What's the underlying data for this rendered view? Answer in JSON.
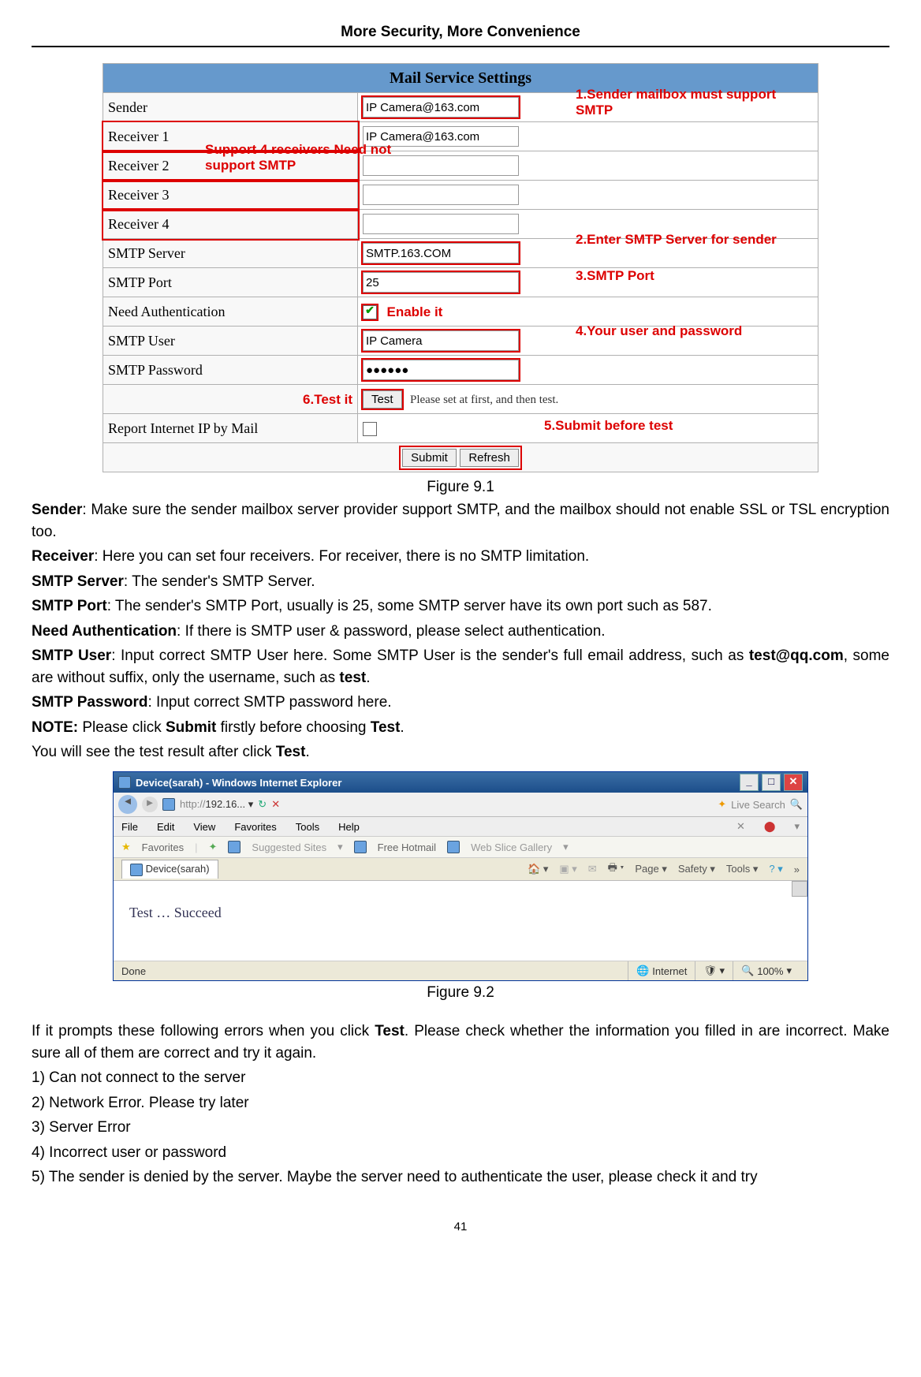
{
  "header": "More Security, More Convenience",
  "mail": {
    "title": "Mail Service Settings",
    "rows": {
      "sender_label": "Sender",
      "sender_val": "IP Camera@163.com",
      "r1_label": "Receiver 1",
      "r1_val": "IP Camera@163.com",
      "r2_label": "Receiver 2",
      "r3_label": "Receiver 3",
      "r4_label": "Receiver 4",
      "smtp_server_label": "SMTP Server",
      "smtp_server_val": "SMTP.163.COM",
      "smtp_port_label": "SMTP Port",
      "smtp_port_val": "25",
      "need_auth_label": "Need Authentication",
      "smtp_user_label": "SMTP User",
      "smtp_user_val": "IP Camera",
      "smtp_pass_label": "SMTP Password",
      "smtp_pass_val": "●●●●●●",
      "test_btn": "Test",
      "test_hint": "Please set at first, and then test.",
      "report_label": "Report Internet IP by Mail",
      "submit_btn": "Submit",
      "refresh_btn": "Refresh"
    },
    "ann": {
      "a1": "1.Sender mailbox must support SMTP",
      "a_recv": "Support 4 receivers Need not support SMTP",
      "a2": "2.Enter SMTP Server for sender",
      "a3": "3.SMTP Port",
      "a_enable": "Enable it",
      "a4": "4.Your user and password",
      "a5": "5.Submit before test",
      "a6": "6.Test it"
    }
  },
  "cap1": "Figure 9.1",
  "desc": {
    "p1a": "Sender",
    "p1b": ": Make sure the sender mailbox server provider support SMTP, and the mailbox should not enable SSL or TSL encryption too.",
    "p2a": "Receiver",
    "p2b": ": Here you can set four receivers. For receiver, there is no SMTP limitation.",
    "p3a": "SMTP Server",
    "p3b": ": The sender's SMTP Server.",
    "p4a": "SMTP Port",
    "p4b": ": The sender's SMTP Port, usually is 25, some SMTP server have its own port such as 587.",
    "p5a": "Need Authentication",
    "p5b": ": If there is SMTP user & password, please select authentication.",
    "p6a": "SMTP User",
    "p6b": ": Input correct SMTP User here. Some SMTP User is the sender's full email address, such as ",
    "p6c": "test@qq.com",
    "p6d": ", some are without suffix, only the username, such as ",
    "p6e": "test",
    "p6f": ".",
    "p7a": "SMTP Password",
    "p7b": ": Input correct SMTP password here.",
    "p8a": "NOTE:",
    "p8b": " Please click ",
    "p8c": "Submit",
    "p8d": " firstly before choosing ",
    "p8e": "Test",
    "p8f": ".",
    "p9a": "You will see the test result after click ",
    "p9b": "Test",
    "p9c": "."
  },
  "ie": {
    "title": "Device(sarah) - Windows Internet Explorer",
    "url_prefix": "http://",
    "url_body": "192.16...",
    "search_hint": "Live Search",
    "menu": [
      "File",
      "Edit",
      "View",
      "Favorites",
      "Tools",
      "Help"
    ],
    "fav_label": "Favorites",
    "suggested": "Suggested Sites",
    "free_hotmail": "Free Hotmail",
    "web_slice": "Web Slice Gallery",
    "tab_name": "Device(sarah)",
    "toolbar_page": "Page",
    "toolbar_safety": "Safety",
    "toolbar_tools": "Tools",
    "body_text": "Test   …   Succeed",
    "status_done": "Done",
    "status_zone": "Internet",
    "status_zoom": "100%"
  },
  "cap2": "Figure 9.2",
  "after": {
    "p1a": "If it prompts these following errors when you click ",
    "p1b": "Test",
    "p1c": ". Please check whether the information you filled in are incorrect. Make sure all of them are correct and try it again.",
    "e1": "1) Can not connect to the server",
    "e2": "2) Network Error. Please try later",
    "e3": "3) Server Error",
    "e4": "4) Incorrect user or password",
    "e5": "5) The sender is denied by the server. Maybe the server need to authenticate the user, please check it and try"
  },
  "pageno": "41"
}
